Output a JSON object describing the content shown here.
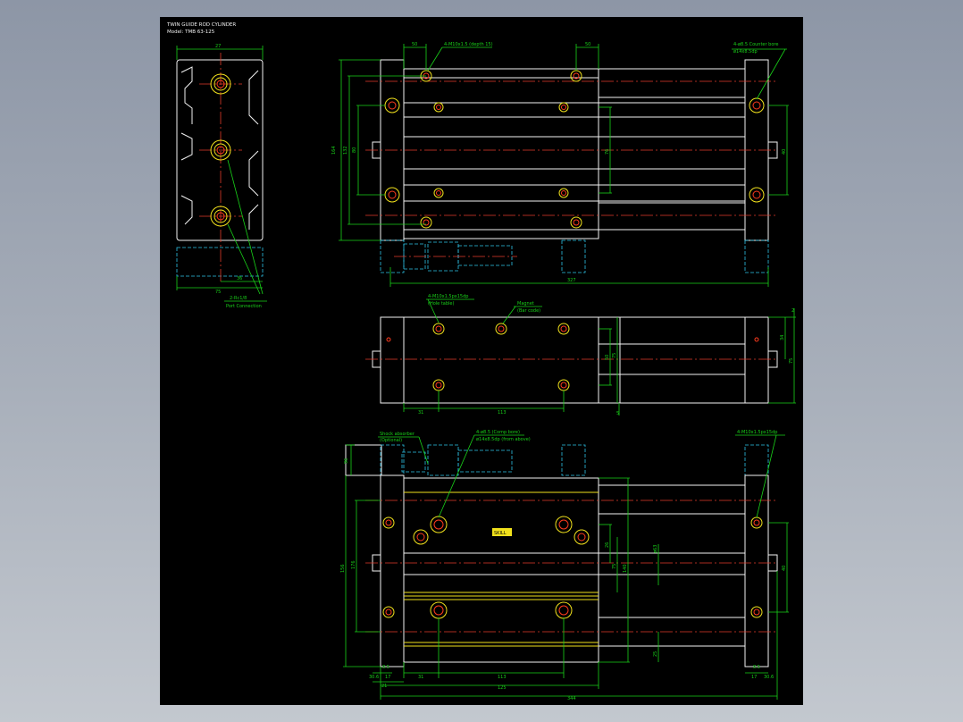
{
  "title": {
    "line1": "TWIN GUIDE ROD CYLINDER",
    "line2": "Model: TMB 63-125"
  },
  "colors": {
    "outline": "#f2f2f2",
    "dimension": "#19d219",
    "centerline": "#e23a2a",
    "hidden": "#2ec3e8",
    "thread": "#f1e11c",
    "background": "#000000"
  },
  "end_view": {
    "dims": {
      "width": "75",
      "top_width": "27",
      "inner": "36"
    },
    "note1": "2-Rc1/8",
    "note2": "Port Connection"
  },
  "top_view": {
    "note1": "4-M10x1.5 (depth 15)",
    "note2": "4-ø8.5 Counter bore",
    "note3": "ø14x8.5dp",
    "dims": {
      "left": "50",
      "right": "50",
      "total": "327",
      "h1": "164",
      "h2": "132",
      "h3": "80",
      "h4": "76",
      "h5": "40"
    }
  },
  "side_view": {
    "note1": "4-M10x1.5px15dp",
    "note1b": "(Hole table)",
    "note2": "Magnet",
    "note2b": "(Bar code)",
    "dims": {
      "d1": "31",
      "d2": "113",
      "d3": "50",
      "d4": "75",
      "d5": "34",
      "d6": "75",
      "d7": "2",
      "d8": "5"
    }
  },
  "front_view": {
    "note1": "Shock absorber",
    "note1b": "(Optional)",
    "note2": "4-ø8.5 (Comp bore)",
    "note2b": "ø14x8.5dp (from above)",
    "note3": "4-M10x1.5px15dp",
    "dims": {
      "a": "31",
      "b": "113",
      "c": "125",
      "d": "344",
      "e": "21",
      "f": "17",
      "g": "8.5",
      "h": "30.6",
      "v1": "156",
      "v2": "176",
      "v3": "26",
      "v4": "75",
      "v5": "140",
      "v6": "ø63",
      "v7": "25",
      "v8": "40",
      "v9": "96"
    },
    "badge": "SKILL"
  }
}
